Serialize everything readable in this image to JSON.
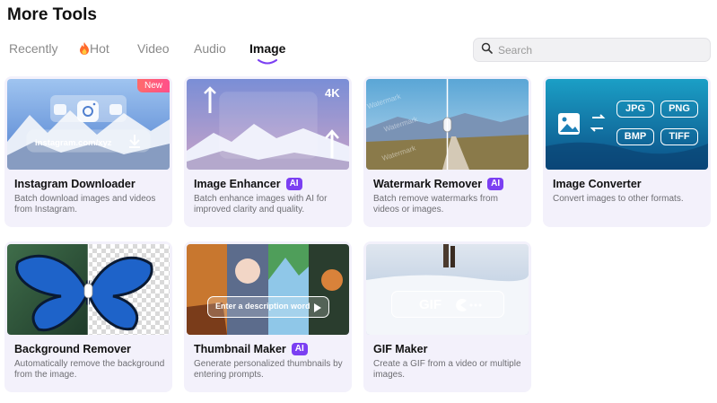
{
  "page": {
    "title": "More Tools"
  },
  "tabs": [
    {
      "label": "Recently",
      "active": false
    },
    {
      "label": "Hot",
      "icon": "fire-icon",
      "active": false
    },
    {
      "label": "Video",
      "active": false
    },
    {
      "label": "Audio",
      "active": false
    },
    {
      "label": "Image",
      "active": true
    }
  ],
  "search": {
    "placeholder": "Search",
    "icon": "search-icon"
  },
  "accent_color": "#7b3ff2",
  "tools": [
    {
      "title": "Instagram Downloader",
      "ai": false,
      "badge": "New",
      "thumb_text": "instagram.com/xyz",
      "description": "Batch download images and videos from Instagram."
    },
    {
      "title": "Image Enhancer",
      "ai": true,
      "ai_label": "AI",
      "thumb_text": "4K",
      "description": "Batch enhance images with AI for improved clarity and quality."
    },
    {
      "title": "Watermark Remover",
      "ai": true,
      "ai_label": "AI",
      "thumb_text": "Watermark",
      "description": "Batch remove watermarks from videos or images."
    },
    {
      "title": "Image Converter",
      "ai": false,
      "formats": [
        "JPG",
        "PNG",
        "BMP",
        "TIFF"
      ],
      "description": "Convert images to other formats."
    },
    {
      "title": "Background Remover",
      "ai": false,
      "description": "Automatically remove the background from the image."
    },
    {
      "title": "Thumbnail Maker",
      "ai": true,
      "ai_label": "AI",
      "thumb_text": "Enter a description word",
      "description": "Generate personalized thumbnails by entering prompts."
    },
    {
      "title": "GIF Maker",
      "ai": false,
      "thumb_text": "GIF",
      "description": "Create a GIF from a video or multiple images."
    }
  ]
}
